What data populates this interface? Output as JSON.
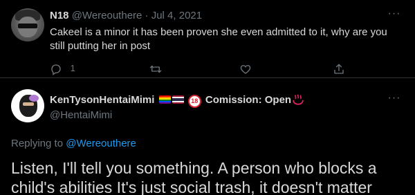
{
  "reply_tweet": {
    "display_name": "N18",
    "handle": "@Wereouthere",
    "separator": "·",
    "date": "Jul 4, 2021",
    "text": "Cakeel is a minor it has been proven she even admitted to it, why are you still putting her in post",
    "more": "···",
    "reply_count": "1",
    "actions": [
      "reply-icon",
      "retweet-icon",
      "like-icon",
      "share-icon"
    ]
  },
  "main_tweet": {
    "display_name": "KenTysonHentaiMimi",
    "name_suffix": "Comission: Open",
    "badge": "18",
    "name_emojis": [
      "rainbow-flag",
      "thailand-flag",
      "no-under-18-icon",
      "hot-springs-icon"
    ],
    "handle": "@HentaiMimi",
    "more": "···",
    "replying_label": "Replying to",
    "replying_mention": "@Wereouthere",
    "text_line1": "Listen, I'll tell you something. A person who blocks a",
    "text_line2": "child's abilities It's just social trash, it doesn't matter"
  },
  "colors": {
    "background": "#000000",
    "text_primary": "#d9d9d9",
    "text_secondary": "#6e767d",
    "link": "#1d9bf0",
    "divider": "#2f3336"
  }
}
